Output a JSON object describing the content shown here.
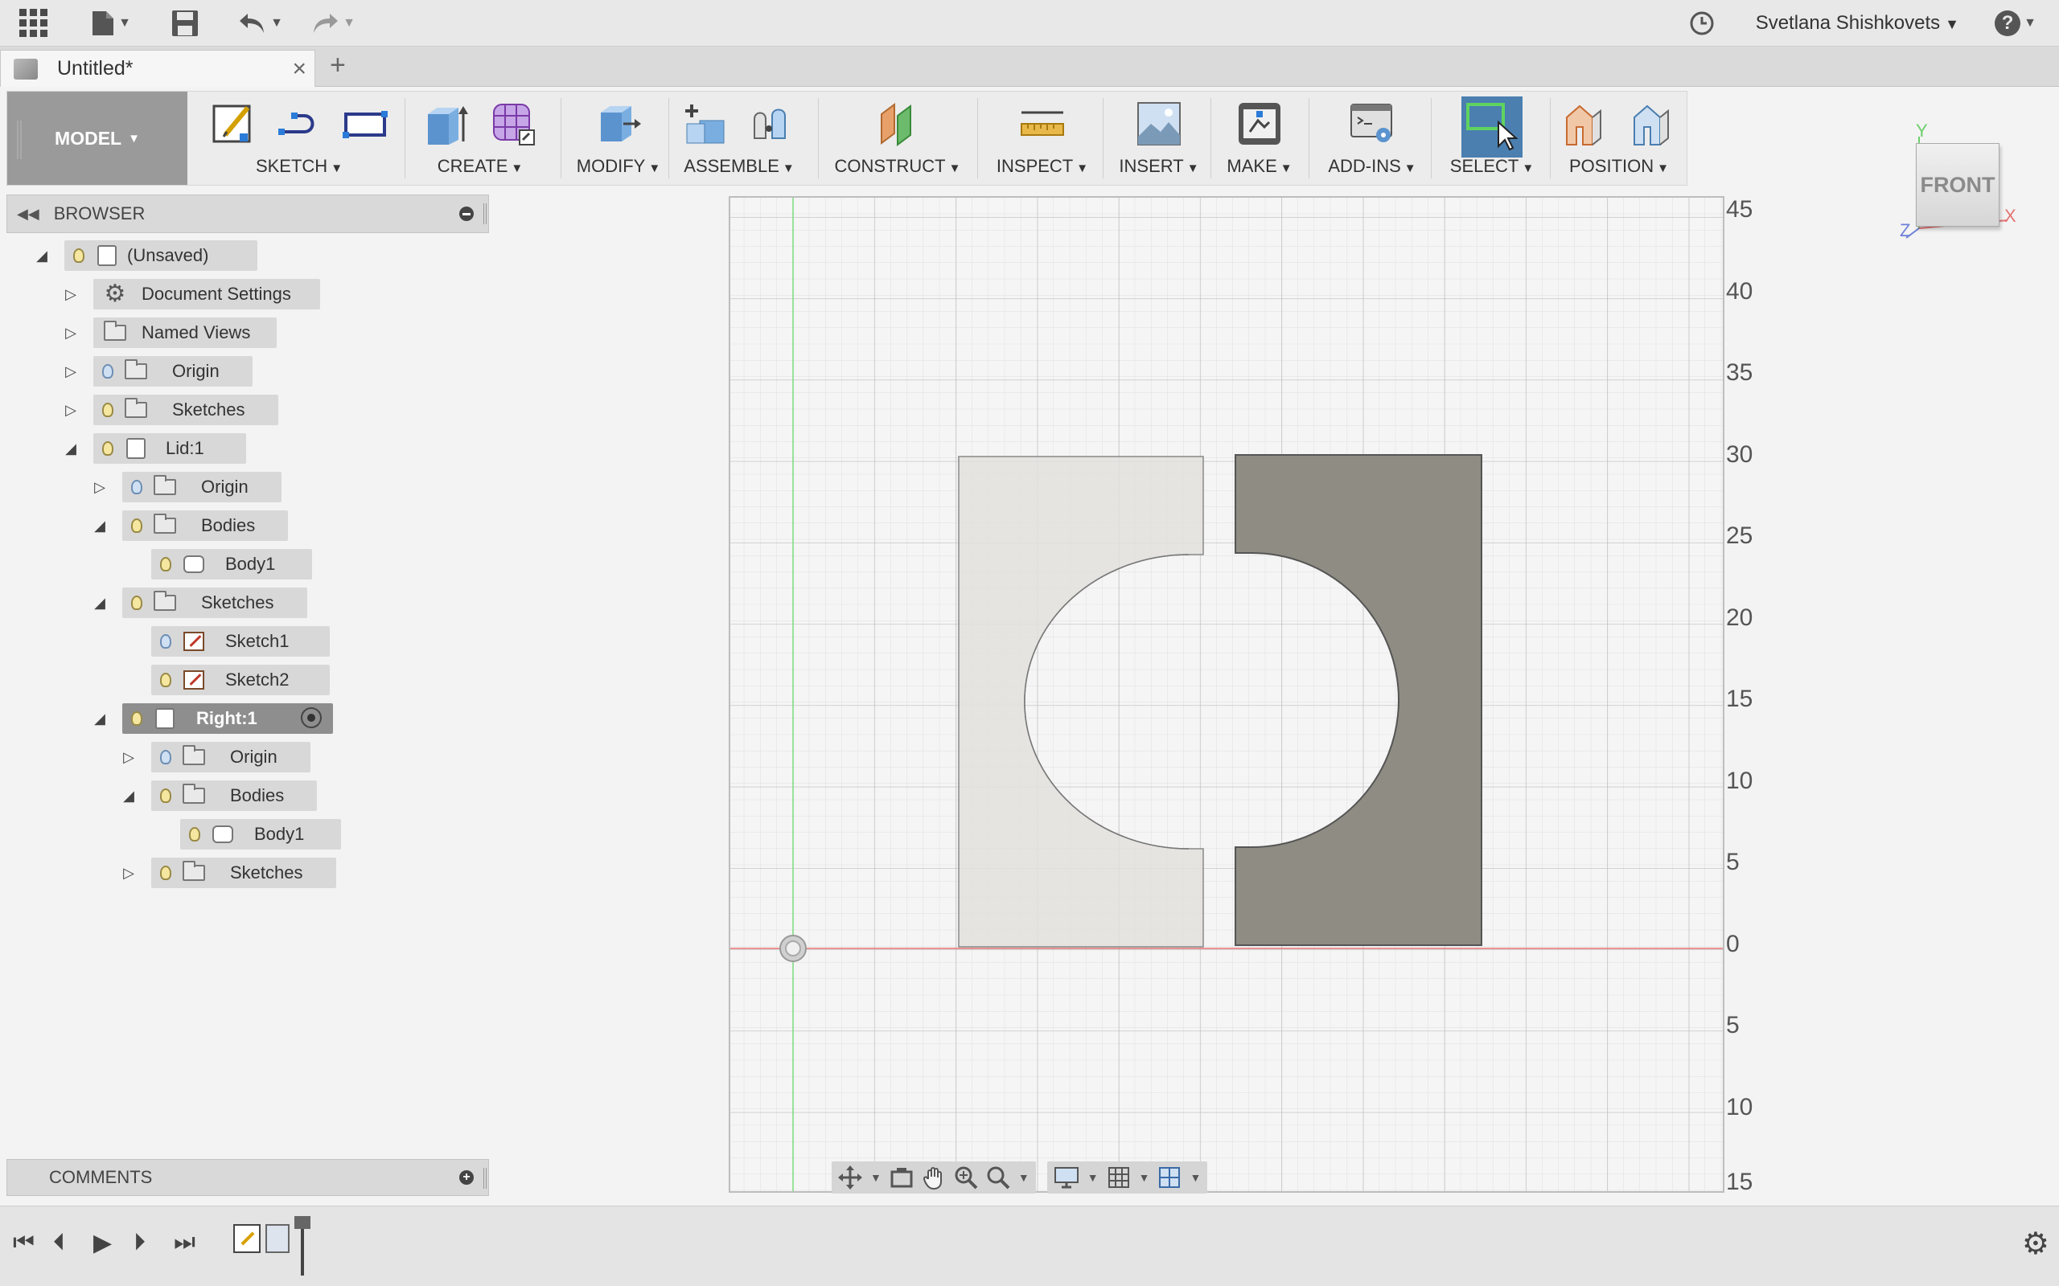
{
  "topbar": {
    "user_name": "Svetlana Shishkovets",
    "help_label": "?"
  },
  "tab": {
    "title": "Untitled*",
    "close": "×",
    "new_tab": "+"
  },
  "toolbar": {
    "workspace": "MODEL",
    "groups": [
      {
        "id": "sketch",
        "label": "SKETCH"
      },
      {
        "id": "create",
        "label": "CREATE"
      },
      {
        "id": "modify",
        "label": "MODIFY"
      },
      {
        "id": "assemble",
        "label": "ASSEMBLE"
      },
      {
        "id": "construct",
        "label": "CONSTRUCT"
      },
      {
        "id": "inspect",
        "label": "INSPECT"
      },
      {
        "id": "insert",
        "label": "INSERT"
      },
      {
        "id": "make",
        "label": "MAKE"
      },
      {
        "id": "addins",
        "label": "ADD-INS"
      },
      {
        "id": "select",
        "label": "SELECT"
      },
      {
        "id": "position",
        "label": "POSITION"
      }
    ]
  },
  "browser": {
    "title": "BROWSER",
    "tree": [
      {
        "label": "(Unsaved)",
        "icon": "component-icon",
        "bulb": "on"
      },
      {
        "label": "Document Settings",
        "icon": "gear-icon",
        "bulb": "none"
      },
      {
        "label": "Named Views",
        "icon": "folder-icon",
        "bulb": "none"
      },
      {
        "label": "Origin",
        "icon": "folder-icon",
        "bulb": "off"
      },
      {
        "label": "Sketches",
        "icon": "folder-icon",
        "bulb": "on"
      },
      {
        "label": "Lid:1",
        "icon": "component-icon",
        "bulb": "on"
      },
      {
        "label": "Origin",
        "icon": "folder-icon",
        "bulb": "off"
      },
      {
        "label": "Bodies",
        "icon": "folder-icon",
        "bulb": "on"
      },
      {
        "label": "Body1",
        "icon": "body-icon",
        "bulb": "on"
      },
      {
        "label": "Sketches",
        "icon": "folder-icon",
        "bulb": "on"
      },
      {
        "label": "Sketch1",
        "icon": "sketch-icon",
        "bulb": "off"
      },
      {
        "label": "Sketch2",
        "icon": "sketch-icon",
        "bulb": "on"
      },
      {
        "label": "Right:1",
        "icon": "component-icon",
        "bulb": "on",
        "active": true
      },
      {
        "label": "Origin",
        "icon": "folder-icon",
        "bulb": "off"
      },
      {
        "label": "Bodies",
        "icon": "folder-icon",
        "bulb": "on"
      },
      {
        "label": "Body1",
        "icon": "body-icon",
        "bulb": "on"
      },
      {
        "label": "Sketches",
        "icon": "folder-icon",
        "bulb": "on"
      }
    ]
  },
  "comments": {
    "title": "COMMENTS"
  },
  "viewcube": {
    "face": "FRONT",
    "x": "X",
    "y": "Y",
    "z": "Z"
  },
  "ruler": {
    "labels": [
      "45",
      "40",
      "35",
      "30",
      "25",
      "20",
      "15",
      "10",
      "5",
      "0",
      "5",
      "10",
      "15"
    ]
  },
  "colors": {
    "lid_fill": "#e2e0dd",
    "right_fill": "#8f8c84",
    "x_axis": "#e57373",
    "y_axis": "#7ddc7d",
    "select_active": "#4a7fb0"
  }
}
